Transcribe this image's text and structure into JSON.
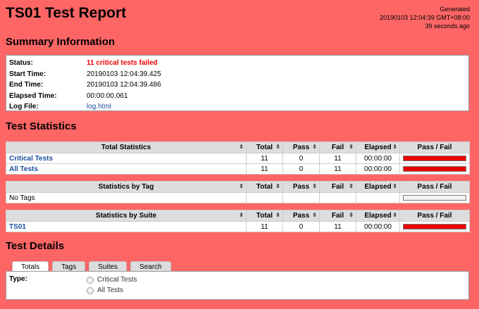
{
  "header": {
    "title": "TS01 Test Report",
    "generated_label": "Generated",
    "generated_time": "20190103 12:04:39 GMT+08:00",
    "ago": "39 seconds ago"
  },
  "sections": {
    "summary": "Summary Information",
    "statistics": "Test Statistics",
    "details": "Test Details"
  },
  "summary": [
    {
      "label": "Status:",
      "value": "11 critical tests failed"
    },
    {
      "label": "Start Time:",
      "value": "20190103 12:04:39.425"
    },
    {
      "label": "End Time:",
      "value": "20190103 12:04:39.486"
    },
    {
      "label": "Elapsed Time:",
      "value": "00:00:00.061"
    },
    {
      "label": "Log File:",
      "value": "log.html"
    }
  ],
  "columns": [
    "Total",
    "Pass",
    "Fail",
    "Elapsed",
    "Pass / Fail"
  ],
  "total_stats": {
    "header": "Total Statistics",
    "rows": [
      {
        "name": "Critical Tests",
        "total": "11",
        "pass": "0",
        "fail": "11",
        "elapsed": "00:00:00",
        "pass_ratio": 0
      },
      {
        "name": "All Tests",
        "total": "11",
        "pass": "0",
        "fail": "11",
        "elapsed": "00:00:00",
        "pass_ratio": 0
      }
    ]
  },
  "tag_stats": {
    "header": "Statistics by Tag",
    "rows": [
      {
        "name": "No Tags"
      }
    ]
  },
  "suite_stats": {
    "header": "Statistics by Suite",
    "rows": [
      {
        "name": "TS01",
        "total": "11",
        "pass": "0",
        "fail": "11",
        "elapsed": "00:00:00",
        "pass_ratio": 0
      }
    ]
  },
  "tabs": [
    "Totals",
    "Tags",
    "Suites",
    "Search"
  ],
  "details": {
    "type_label": "Type:",
    "options": [
      "Critical Tests",
      "All Tests"
    ]
  },
  "colors": {
    "background": "#fe6666",
    "fail_bar": "#ee0000",
    "link": "#1b4f9c"
  }
}
